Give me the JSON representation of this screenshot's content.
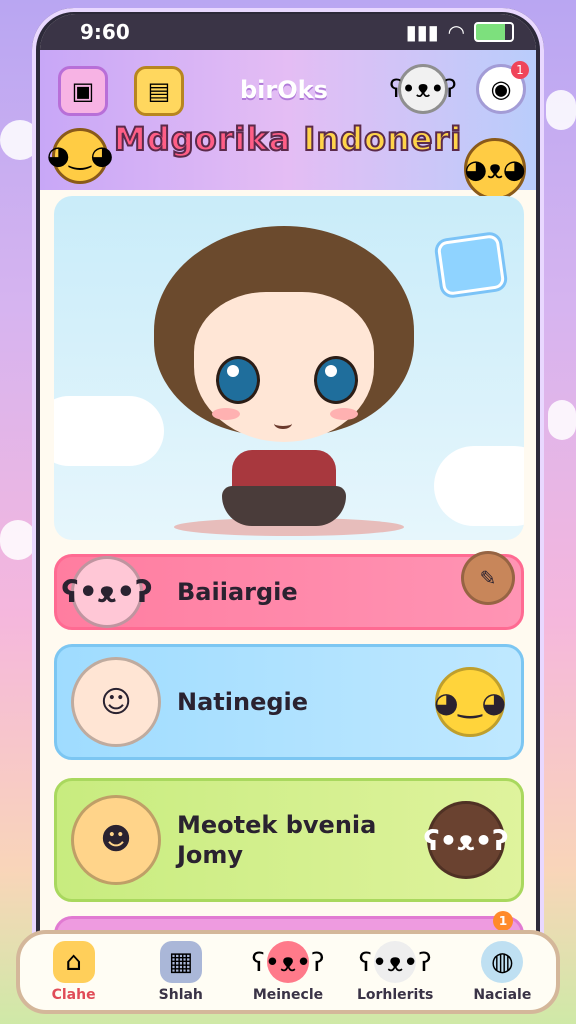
{
  "status_bar": {
    "time": "9:60"
  },
  "header": {
    "title": "birOks",
    "brand_part1": "Mdgorika",
    "brand_part2": "Indoneri",
    "notification_count": "1"
  },
  "cards": [
    {
      "label": "Baiiargie"
    },
    {
      "label": "Natinegie"
    },
    {
      "label_line1": "Meotek bvenia",
      "label_line2": "Jomy"
    },
    {
      "label": ""
    }
  ],
  "card4_badge": "1",
  "nav": [
    {
      "label": "Clahe",
      "icon": "home-icon",
      "active": true
    },
    {
      "label": "Shlah",
      "icon": "building-icon"
    },
    {
      "label": "Meinecle",
      "icon": "bear-icon"
    },
    {
      "label": "Lorhlerits",
      "icon": "bear-white-icon"
    },
    {
      "label": "Naciale",
      "icon": "globe-icon"
    }
  ],
  "colors": {
    "accent_pink": "#ff7da0",
    "accent_blue": "#9fdcff",
    "accent_green": "#c8ec7f",
    "nav_active": "#e04c58"
  }
}
